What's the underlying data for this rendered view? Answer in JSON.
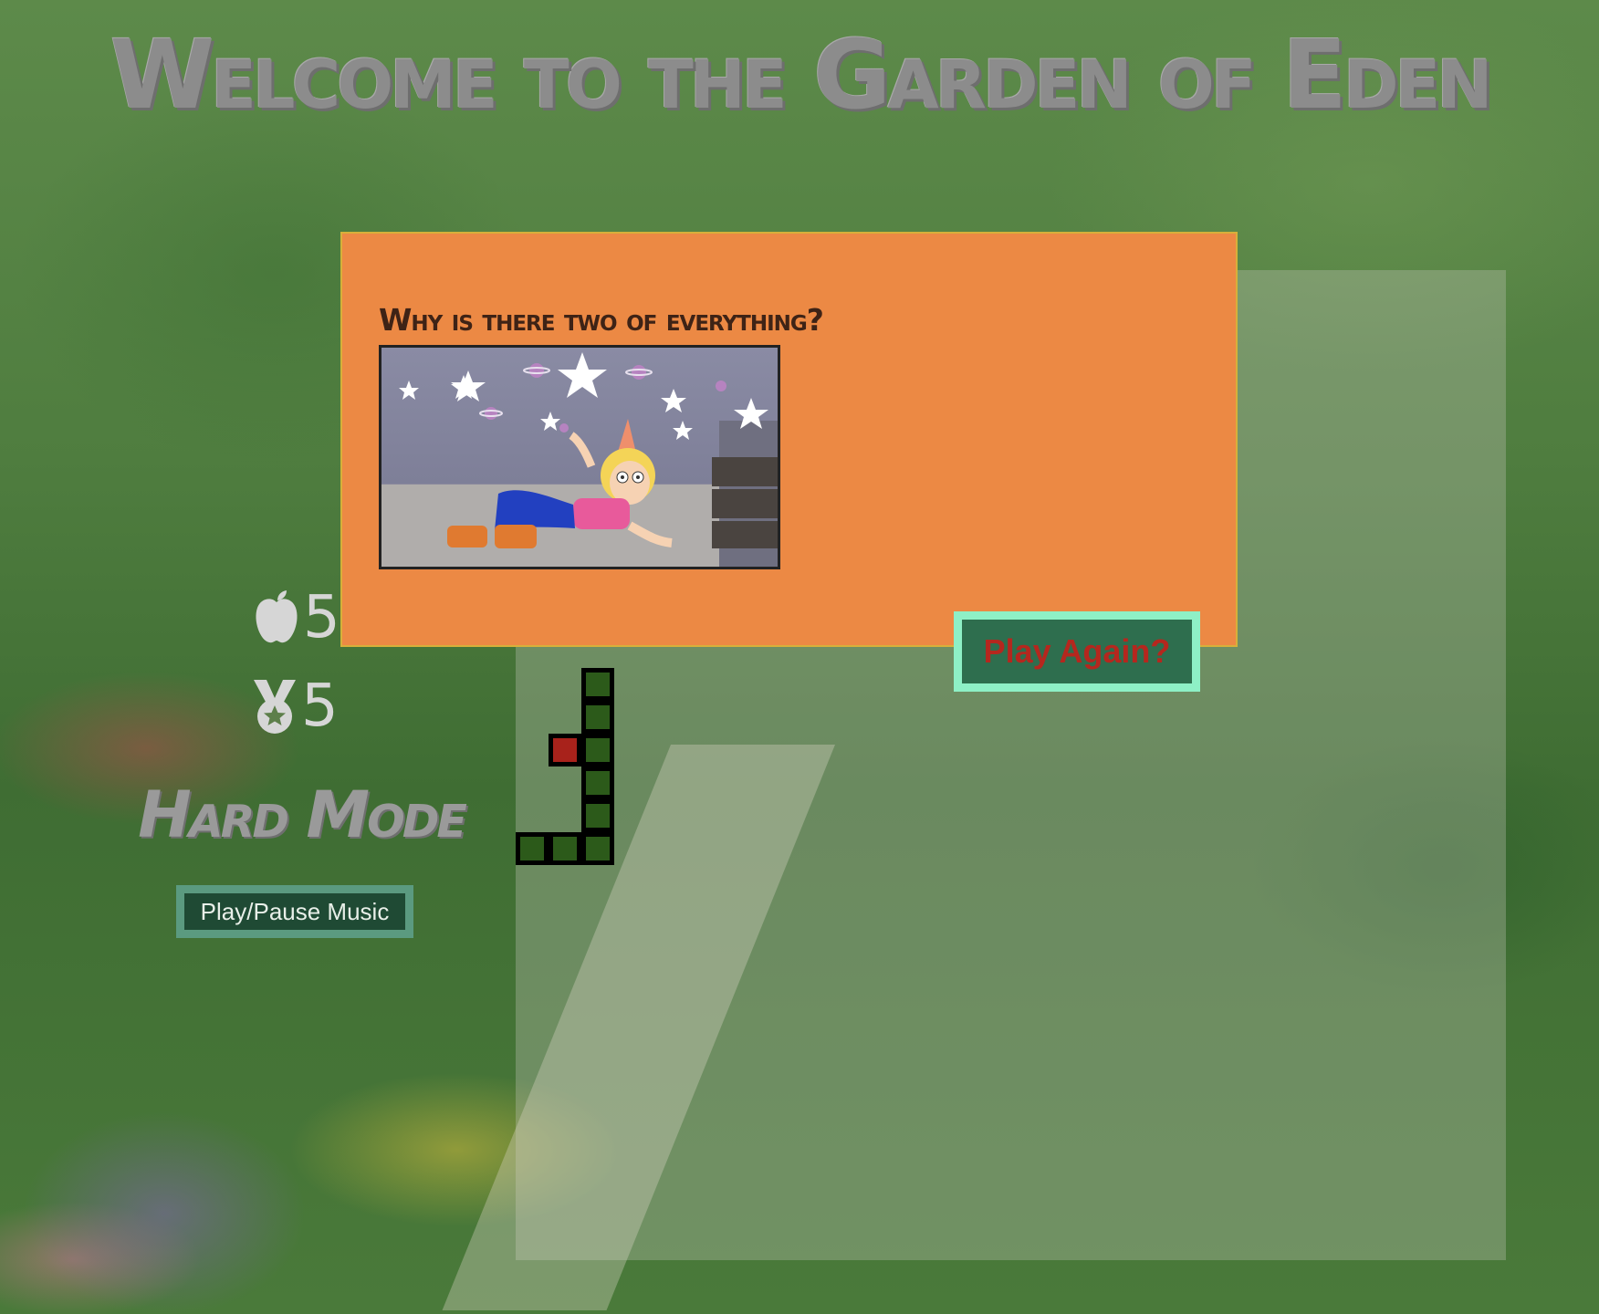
{
  "page": {
    "title": "Welcome to the Garden of Eden"
  },
  "stats": {
    "apples_icon": "apple-icon",
    "apples_value": "5",
    "medal_icon": "medal-icon",
    "medal_value": "5"
  },
  "mode": {
    "label": "Hard Mode"
  },
  "controls": {
    "music_button_label": "Play/Pause Music"
  },
  "game_over_modal": {
    "heading": "Why is there two of everything?",
    "gif_icon": "cartoon-girl-seeing-stars-gif",
    "play_again_label": "Play Again?"
  },
  "colors": {
    "modal_background": "#ec8944",
    "snake_body": "#2c5a1a",
    "food": "#a8221b",
    "play_again_border": "#8ef0c6",
    "play_again_text": "#b5271e",
    "music_button_border": "#5b9a80"
  }
}
